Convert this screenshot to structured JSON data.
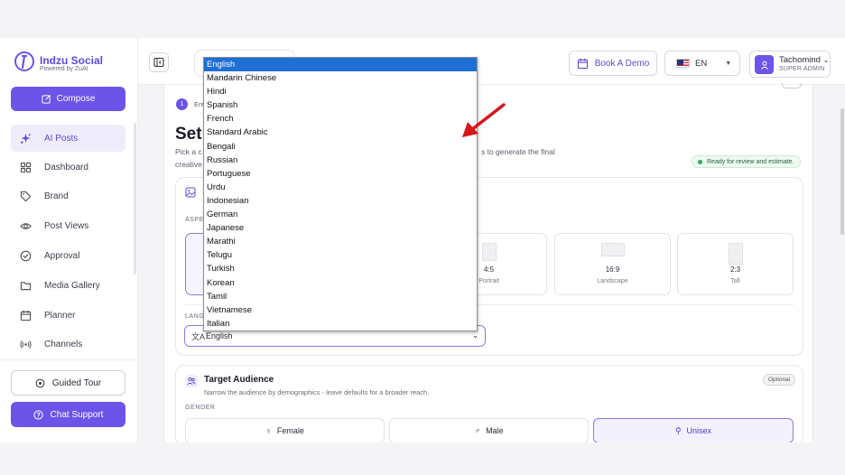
{
  "app": {
    "brand": "Indzu Social",
    "powered_by": "Powered by ZuAI"
  },
  "sidebar": {
    "compose": "Compose",
    "items": [
      {
        "label": "AI Posts",
        "icon": "sparkles-icon",
        "active": true
      },
      {
        "label": "Dashboard",
        "icon": "grid-icon",
        "active": false
      },
      {
        "label": "Brand",
        "icon": "tag-icon",
        "active": false
      },
      {
        "label": "Post Views",
        "icon": "eye-icon",
        "active": false
      },
      {
        "label": "Approval",
        "icon": "check-circle-icon",
        "active": false
      },
      {
        "label": "Media Gallery",
        "icon": "folder-icon",
        "active": false
      },
      {
        "label": "Planner",
        "icon": "calendar-icon",
        "active": false
      },
      {
        "label": "Channels",
        "icon": "broadcast-icon",
        "active": false
      }
    ],
    "guided_tour": "Guided Tour",
    "chat_support": "Chat Support"
  },
  "header": {
    "book_demo": "Book A Demo",
    "language": "EN",
    "user_name": "Tachomind",
    "user_role": "SUPER ADMIN"
  },
  "content": {
    "step_number": "1",
    "step_label": "Ent",
    "title": "Set",
    "pick_text": "Pick a c",
    "creative_text": "creative",
    "generate_text": "s to generate the final",
    "ready_badge": "Ready for review and estimate.",
    "aspect_label": "ASPE",
    "aspect_options": [
      {
        "value": "4:5",
        "sub": "Portrait"
      },
      {
        "value": "16:9",
        "sub": "Landscape"
      },
      {
        "value": "2:3",
        "sub": "Tall"
      }
    ],
    "language_label": "LANG",
    "language_glyph": "文A",
    "language_value": "English"
  },
  "audience": {
    "title": "Target Audience",
    "subtitle": "Narrow the audience by demographics - leave defaults for a broader reach.",
    "optional": "Optional",
    "gender_label": "GENDER",
    "genders": [
      {
        "label": "Female",
        "symbol": "♀",
        "selected": false
      },
      {
        "label": "Male",
        "symbol": "♂",
        "selected": false
      },
      {
        "label": "Unisex",
        "symbol": "⚲",
        "selected": true
      }
    ]
  },
  "language_dropdown": {
    "selected": "English",
    "options": [
      "English",
      "Mandarin Chinese",
      "Hindi",
      "Spanish",
      "French",
      "Standard Arabic",
      "Bengali",
      "Russian",
      "Portuguese",
      "Urdu",
      "Indonesian",
      "German",
      "Japanese",
      "Marathi",
      "Telugu",
      "Turkish",
      "Korean",
      "Tamil",
      "Vietnamese",
      "Italian"
    ]
  },
  "colors": {
    "accent": "#6c54e8",
    "highlight": "#1f6fd6",
    "annotation_arrow": "#d8161b"
  }
}
